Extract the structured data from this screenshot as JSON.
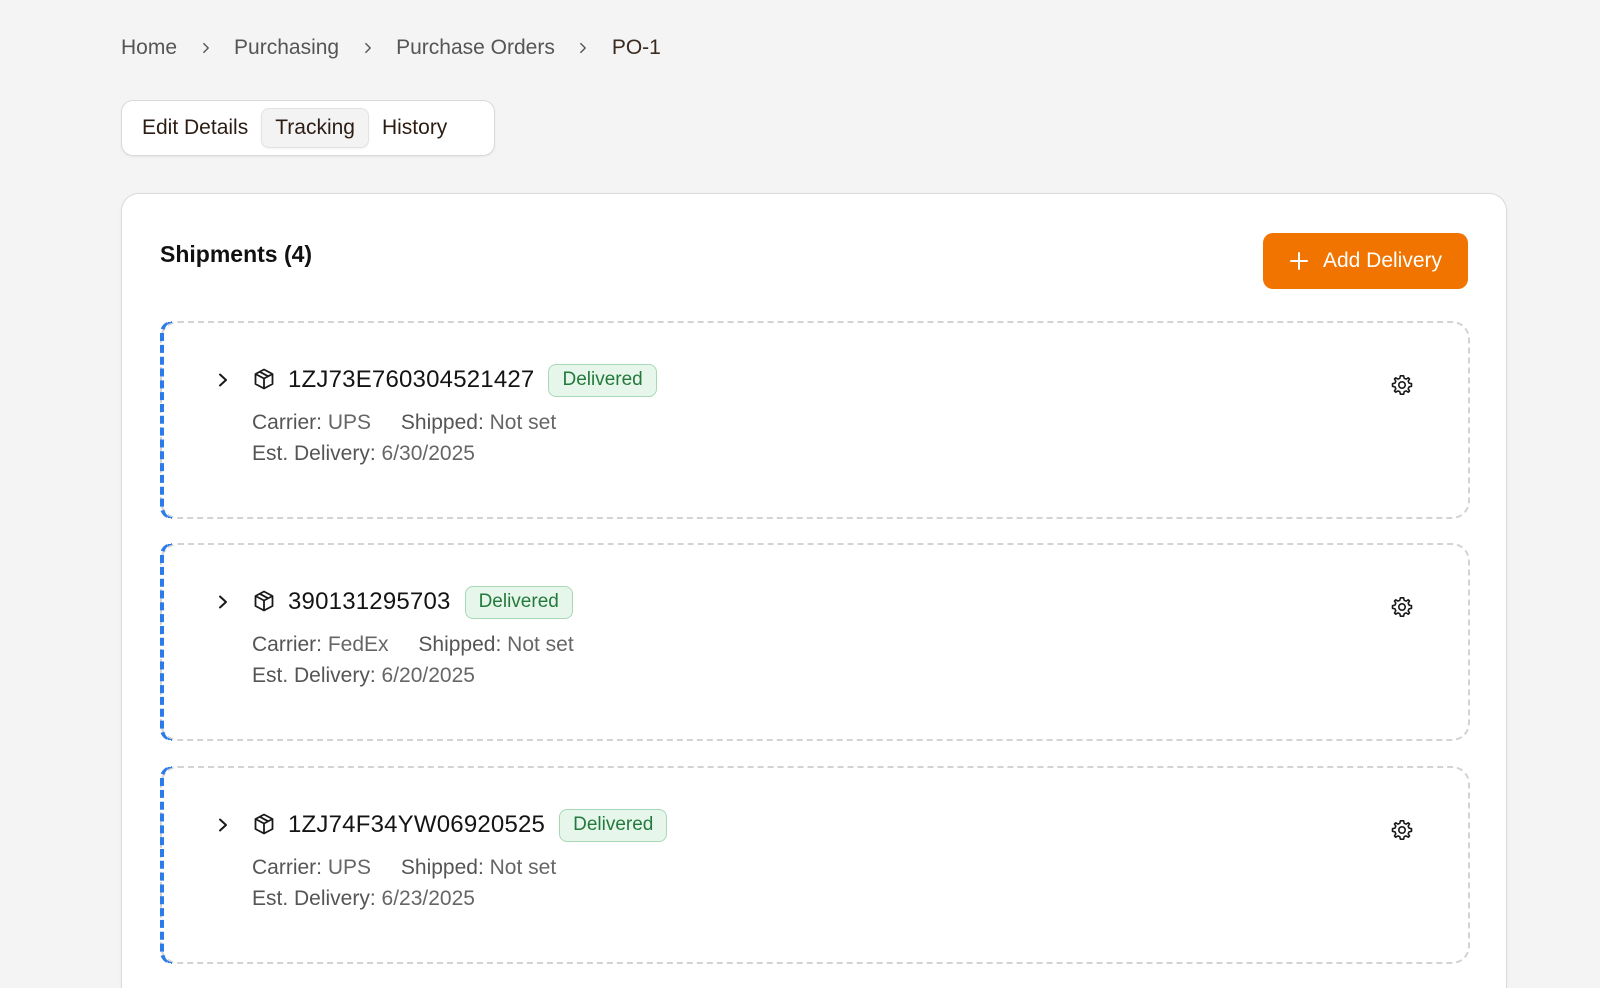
{
  "breadcrumb": [
    {
      "label": "Home"
    },
    {
      "label": "Purchasing"
    },
    {
      "label": "Purchase Orders"
    },
    {
      "label": "PO-1"
    }
  ],
  "tabs": [
    {
      "label": "Edit Details"
    },
    {
      "label": "Tracking",
      "active": true
    },
    {
      "label": "History"
    }
  ],
  "shipments_section": {
    "title": "Shipments (4)",
    "add_button_label": "Add Delivery"
  },
  "labels": {
    "carrier": "Carrier:",
    "shipped": "Shipped:",
    "est_delivery": "Est. Delivery:"
  },
  "shipments": [
    {
      "tracking": "1ZJ73E760304521427",
      "status": "Delivered",
      "carrier": "UPS",
      "shipped": "Not set",
      "est_delivery": "6/30/2025"
    },
    {
      "tracking": "390131295703",
      "status": "Delivered",
      "carrier": "FedEx",
      "shipped": "Not set",
      "est_delivery": "6/20/2025"
    },
    {
      "tracking": "1ZJ74F34YW06920525",
      "status": "Delivered",
      "carrier": "UPS",
      "shipped": "Not set",
      "est_delivery": "6/23/2025"
    }
  ],
  "colors": {
    "accent_orange": "#f17400",
    "accent_blue": "#2b7bea",
    "badge_green_bg": "#e6f6ea",
    "badge_green_text": "#247a3d"
  },
  "icons": {
    "breadcrumb_separator": "chevron-right-icon",
    "add": "plus-icon",
    "expand": "chevron-right-icon",
    "package": "package-icon",
    "settings": "gear-icon"
  }
}
